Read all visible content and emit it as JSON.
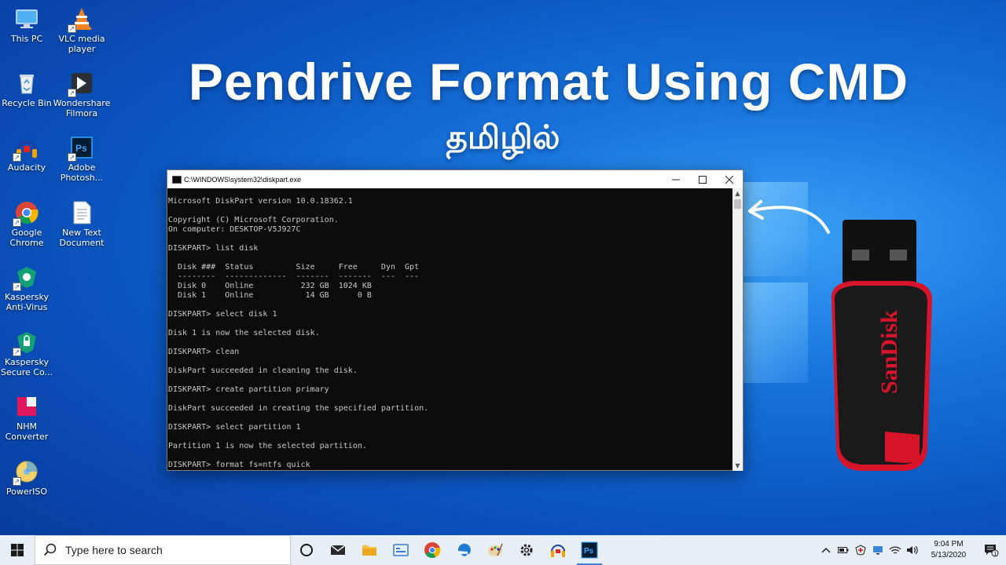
{
  "desktop": {
    "icons": [
      {
        "label": "This PC",
        "icon": "this-pc-icon"
      },
      {
        "label": "VLC media player",
        "icon": "vlc-icon"
      },
      {
        "label": "Recycle Bin",
        "icon": "recycle-bin-icon"
      },
      {
        "label": "Wondershare Filmora",
        "icon": "filmora-icon"
      },
      {
        "label": "Audacity",
        "icon": "audacity-icon"
      },
      {
        "label": "Adobe Photosh...",
        "icon": "photoshop-icon"
      },
      {
        "label": "Google Chrome",
        "icon": "chrome-icon"
      },
      {
        "label": "New Text Document",
        "icon": "text-document-icon"
      },
      {
        "label": "Kaspersky Anti-Virus",
        "icon": "kaspersky-antivirus-icon"
      },
      {
        "label": "Kaspersky Secure Co...",
        "icon": "kaspersky-secure-icon"
      },
      {
        "label": "NHM Converter",
        "icon": "nhm-converter-icon"
      },
      {
        "label": "PowerISO",
        "icon": "poweriso-icon"
      }
    ]
  },
  "headline": {
    "title": "Pendrive Format Using CMD",
    "subtitle": "தமிழில்"
  },
  "cmd_window": {
    "title": "C:\\WINDOWS\\system32\\diskpart.exe",
    "lines": [
      "Microsoft DiskPart version 10.0.18362.1",
      "",
      "Copyright (C) Microsoft Corporation.",
      "On computer: DESKTOP-V5J927C",
      "",
      "DISKPART> list disk",
      "",
      "  Disk ###  Status         Size     Free     Dyn  Gpt",
      "  --------  -------------  -------  -------  ---  ---",
      "  Disk 0    Online          232 GB  1024 KB",
      "  Disk 1    Online           14 GB      0 B",
      "",
      "DISKPART> select disk 1",
      "",
      "Disk 1 is now the selected disk.",
      "",
      "DISKPART> clean",
      "",
      "DiskPart succeeded in cleaning the disk.",
      "",
      "DISKPART> create partition primary",
      "",
      "DiskPart succeeded in creating the specified partition.",
      "",
      "DISKPART> select partition 1",
      "",
      "Partition 1 is now the selected partition.",
      "",
      "DISKPART> format fs=ntfs quick"
    ]
  },
  "usb": {
    "brand": "SanDisk"
  },
  "taskbar": {
    "search_placeholder": "Type here to search",
    "apps": [
      "cortana-icon",
      "mail-icon",
      "file-explorer-icon",
      "calendar-icon",
      "chrome-icon",
      "edge-icon",
      "paint-icon",
      "settings-icon",
      "audacity-icon",
      "photoshop-icon"
    ],
    "time": "9:04 PM",
    "date": "5/13/2020",
    "notification_count": "1"
  },
  "colors": {
    "accent": "#1876de",
    "usb_red": "#d7142a"
  }
}
